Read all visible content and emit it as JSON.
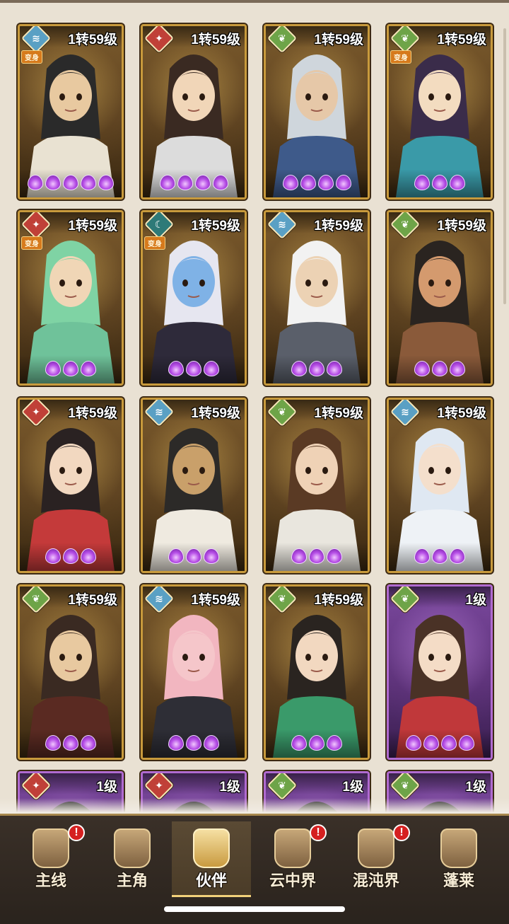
{
  "partners": [
    {
      "level": "1转59级",
      "element": "water",
      "badge": "变身",
      "stars": 5,
      "frame": "gold",
      "hair": "#2a2a2a",
      "skin": "#e8c9a0",
      "robe": "#e9e2d2"
    },
    {
      "level": "1转59级",
      "element": "fire",
      "badge": "",
      "stars": 4,
      "frame": "gold",
      "hair": "#3a2a22",
      "skin": "#f1d6b8",
      "robe": "#dcdcdc"
    },
    {
      "level": "1转59级",
      "element": "wood",
      "badge": "",
      "stars": 4,
      "frame": "gold",
      "hair": "#cfd6dc",
      "skin": "#e6c8a8",
      "robe": "#3e5a8a"
    },
    {
      "level": "1转59级",
      "element": "wood",
      "badge": "变身",
      "stars": 3,
      "frame": "gold",
      "hair": "#3a2c4a",
      "skin": "#f3dcc0",
      "robe": "#3a9aa8"
    },
    {
      "level": "1转59级",
      "element": "fire",
      "badge": "变身",
      "stars": 3,
      "frame": "gold",
      "hair": "#7fd3a4",
      "skin": "#f0d6b6",
      "robe": "#6fc29a"
    },
    {
      "level": "1转59级",
      "element": "dark",
      "badge": "变身",
      "stars": 3,
      "frame": "gold",
      "hair": "#e6e6f0",
      "skin": "#7fb2e6",
      "robe": "#2e2a3a"
    },
    {
      "level": "1转59级",
      "element": "water",
      "badge": "",
      "stars": 3,
      "frame": "gold",
      "hair": "#f2f2f2",
      "skin": "#ecd2b4",
      "robe": "#5a5f6a"
    },
    {
      "level": "1转59级",
      "element": "wood",
      "badge": "",
      "stars": 3,
      "frame": "gold",
      "hair": "#2a2420",
      "skin": "#d49a6e",
      "robe": "#8a5a3a"
    },
    {
      "level": "1转59级",
      "element": "fire",
      "badge": "",
      "stars": 3,
      "frame": "gold",
      "hair": "#2a2222",
      "skin": "#f2d8c0",
      "robe": "#c43a3a"
    },
    {
      "level": "1转59级",
      "element": "water",
      "badge": "",
      "stars": 3,
      "frame": "gold",
      "hair": "#2c2a28",
      "skin": "#c9a06a",
      "robe": "#efeae0"
    },
    {
      "level": "1转59级",
      "element": "wood",
      "badge": "",
      "stars": 3,
      "frame": "gold",
      "hair": "#5a3a24",
      "skin": "#efd2b6",
      "robe": "#e9e6de"
    },
    {
      "level": "1转59级",
      "element": "water",
      "badge": "",
      "stars": 3,
      "frame": "gold",
      "hair": "#dfe8f2",
      "skin": "#f4dfcc",
      "robe": "#eef2f6"
    },
    {
      "level": "1转59级",
      "element": "wood",
      "badge": "",
      "stars": 3,
      "frame": "gold",
      "hair": "#3a2a22",
      "skin": "#e8c9a0",
      "robe": "#5a2a22"
    },
    {
      "level": "1转59级",
      "element": "water",
      "badge": "",
      "stars": 3,
      "frame": "gold",
      "hair": "#f2b6c0",
      "skin": "#f5c6ca",
      "robe": "#2e2e36"
    },
    {
      "level": "1转59级",
      "element": "wood",
      "badge": "",
      "stars": 3,
      "frame": "gold",
      "hair": "#2a2420",
      "skin": "#f2d8c0",
      "robe": "#3a9a6a"
    },
    {
      "level": "1级",
      "element": "wood",
      "badge": "",
      "stars": 4,
      "frame": "purple",
      "hair": "#4a3226",
      "skin": "#f4dcc6",
      "robe": "#c0383a"
    },
    {
      "level": "1级",
      "element": "fire",
      "badge": "",
      "stars": 0,
      "frame": "purple",
      "hair": "#2a2a2a",
      "skin": "#e8c9a0",
      "robe": "#5a3a6a"
    },
    {
      "level": "1级",
      "element": "fire",
      "badge": "",
      "stars": 0,
      "frame": "purple",
      "hair": "#2a2a2a",
      "skin": "#e8c9a0",
      "robe": "#5a3a6a"
    },
    {
      "level": "1级",
      "element": "wood",
      "badge": "",
      "stars": 0,
      "frame": "purple",
      "hair": "#2a2a2a",
      "skin": "#e8c9a0",
      "robe": "#5a3a6a"
    },
    {
      "level": "1级",
      "element": "wood",
      "badge": "",
      "stars": 0,
      "frame": "purple",
      "hair": "#2a2a2a",
      "skin": "#e8c9a0",
      "robe": "#5a3a6a"
    }
  ],
  "nav": {
    "items": [
      {
        "label": "主线",
        "alert": "!"
      },
      {
        "label": "主角",
        "alert": ""
      },
      {
        "label": "伙伴",
        "alert": ""
      },
      {
        "label": "云中界",
        "alert": "!"
      },
      {
        "label": "混沌界",
        "alert": "!"
      },
      {
        "label": "蓬莱",
        "alert": ""
      }
    ],
    "active": 2
  },
  "colors": {
    "frame_gold": "#c89a3c",
    "frame_purple": "#b06ad0",
    "star_purple": "#b64ee6",
    "element_water": "#5aa0c4",
    "element_fire": "#c04038",
    "element_wood": "#6ea448",
    "element_dark": "#2e7a78",
    "alert_red": "#d52020"
  },
  "icons": {
    "element_water": "water-element-icon",
    "element_fire": "fire-element-icon",
    "element_wood": "wood-element-icon",
    "element_dark": "dark-element-icon",
    "star": "purple-flame-star-icon",
    "nav": [
      "crossed-swords-icon",
      "hero-bust-icon",
      "crown-helmet-icon",
      "cloud-pavilion-icon",
      "chaos-bell-icon",
      "penglai-sage-icon"
    ]
  }
}
